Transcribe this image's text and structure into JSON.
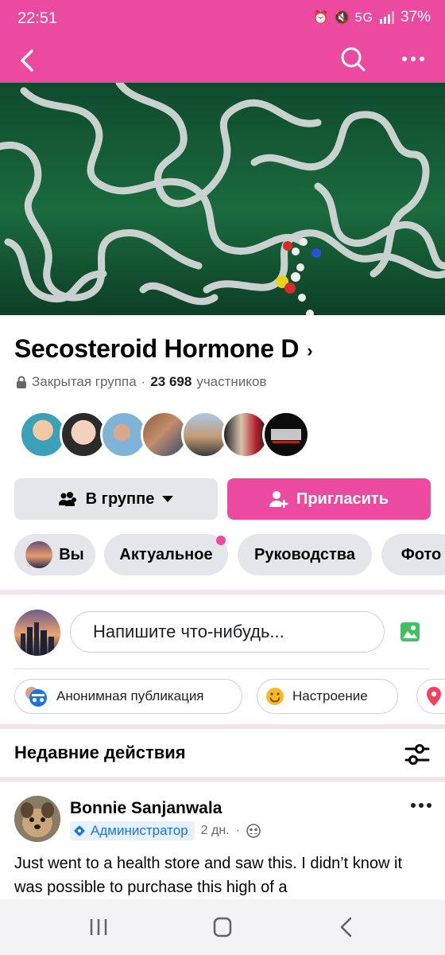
{
  "status_bar": {
    "time": "22:51",
    "icons": "⏰ 🔇 5G",
    "battery": "37%"
  },
  "top_bar": {
    "back_icon": "back-arrow-icon",
    "search_icon": "search-icon",
    "more_icon": "more-dots-icon",
    "color": "#ec4aa0"
  },
  "group": {
    "title": "Secosteroid Hormone D",
    "title_chevron": "›",
    "privacy": "Закрытая группа",
    "separator": "·",
    "member_count": "23 698",
    "member_label": "участников"
  },
  "actions": {
    "joined_label": "В группе",
    "invite_label": "Пригласить"
  },
  "tabs": [
    {
      "label": "Вы"
    },
    {
      "label": "Актуальное",
      "has_dot": true
    },
    {
      "label": "Руководства"
    },
    {
      "label": "Фото"
    }
  ],
  "composer": {
    "placeholder": "Напишите что-нибудь..."
  },
  "composer_options": [
    {
      "label": "Анонимная публикация",
      "icon": "anonymous-icon"
    },
    {
      "label": "Настроение",
      "icon": "smiley-icon"
    }
  ],
  "recent": {
    "title": "Недавние действия"
  },
  "post": {
    "author": "Bonnie Sanjanwala",
    "badge": "Администратор",
    "time": "2 дн.",
    "time_separator": "·",
    "text": "Just went to a health store and saw this. I didn’t know it was possible to purchase this high of a"
  },
  "colors": {
    "accent": "#ec4aa0",
    "admin_blue": "#1b74e4",
    "chip_bg": "#e4e6eb"
  }
}
